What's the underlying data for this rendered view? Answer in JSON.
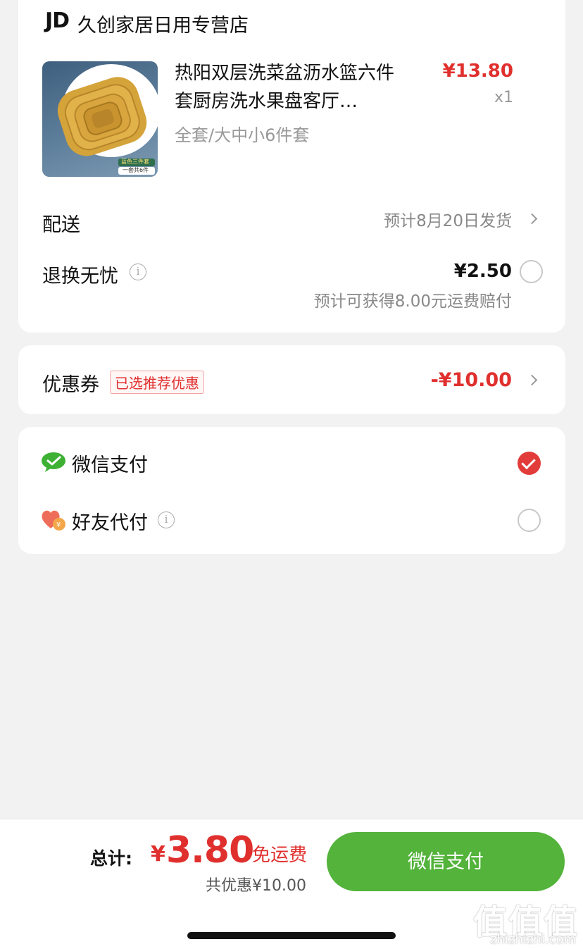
{
  "store": {
    "logo": "JD",
    "name": "久创家居日用专营店"
  },
  "product": {
    "title": "热阳双层洗菜盆沥水篮六件套厨房洗水果盘客厅…",
    "spec": "全套/大中小6件套",
    "price": "¥13.80",
    "qty": "x1",
    "thumb_text": {
      "label": "蓝色三件套",
      "sub": "一套共6件"
    }
  },
  "delivery": {
    "label": "配送",
    "value": "预计8月20日发货"
  },
  "return_service": {
    "label": "退换无忧",
    "price": "¥2.50",
    "note": "预计可获得8.00元运费赔付",
    "selected": false
  },
  "coupon": {
    "label": "优惠券",
    "tag": "已选推荐优惠",
    "value": "-¥10.00"
  },
  "payment": {
    "options": [
      {
        "label": "微信支付",
        "icon": "wechat-pay-icon",
        "selected": true
      },
      {
        "label": "好友代付",
        "icon": "friend-pay-heart-icon",
        "selected": false
      }
    ]
  },
  "footer": {
    "total_label": "总计:",
    "currency": "¥",
    "total": "3.80",
    "free_shipping": "免运费",
    "discount": "共优惠¥10.00",
    "pay_button": "微信支付"
  },
  "watermark": {
    "text": "值值值",
    "url": "zhizhizhi.com"
  },
  "colors": {
    "accent_red": "#e0302e",
    "wechat_green": "#53b33b",
    "background": "#f2f2f2"
  }
}
